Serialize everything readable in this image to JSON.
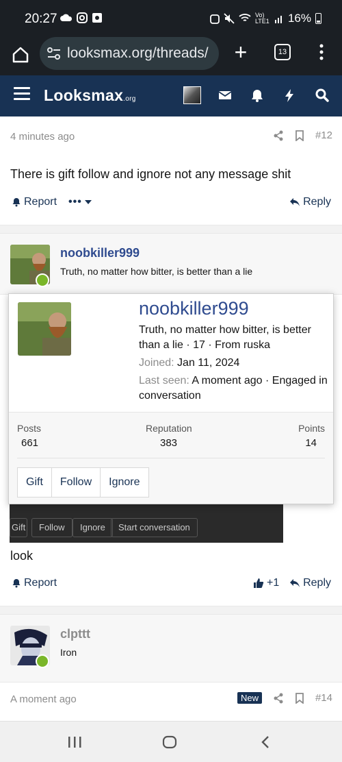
{
  "status_bar": {
    "time": "20:27",
    "network": "Vo) LTE1",
    "battery": "16%"
  },
  "browser": {
    "url": "looksmax.org/threads/",
    "tab_count": "13"
  },
  "site": {
    "logo_main": "Looksmax",
    "logo_sub": ".org"
  },
  "post12": {
    "time": "4 minutes ago",
    "number": "#12",
    "body": "There is gift follow and ignore not any message shit",
    "report_label": "Report",
    "more_label": "•••",
    "reply_label": "Reply"
  },
  "post13": {
    "username": "noobkiller999",
    "user_title": "Truth, no matter how bitter, is better than a lie",
    "embed_buttons": [
      "Gift",
      "Follow",
      "Ignore",
      "Start conversation"
    ],
    "body": "look",
    "report_label": "Report",
    "reactions": "+1",
    "reply_label": "Reply"
  },
  "popup": {
    "username": "noobkiller999",
    "info_line": "Truth, no matter how bitter, is better than a lie · 17 · From ruska",
    "joined_label": "Joined:",
    "joined_value": "Jan 11, 2024",
    "last_seen_label": "Last seen:",
    "last_seen_value": "A moment ago · Engaged in conversation",
    "stats": {
      "posts_label": "Posts",
      "posts_value": "661",
      "reputation_label": "Reputation",
      "reputation_value": "383",
      "points_label": "Points",
      "points_value": "14"
    },
    "buttons": [
      "Gift",
      "Follow",
      "Ignore"
    ]
  },
  "post14": {
    "username": "clpttt",
    "user_title": "Iron",
    "time": "A moment ago",
    "badge": "New",
    "number": "#14"
  },
  "icons": {
    "share": "share-icon",
    "bookmark": "bookmark-icon",
    "bell": "bell-icon",
    "reply": "reply-icon",
    "thumbs_up": "thumbs-up-icon"
  },
  "colors": {
    "header_bg": "#183254",
    "link": "#2f4b8f",
    "online": "#7ab629"
  }
}
